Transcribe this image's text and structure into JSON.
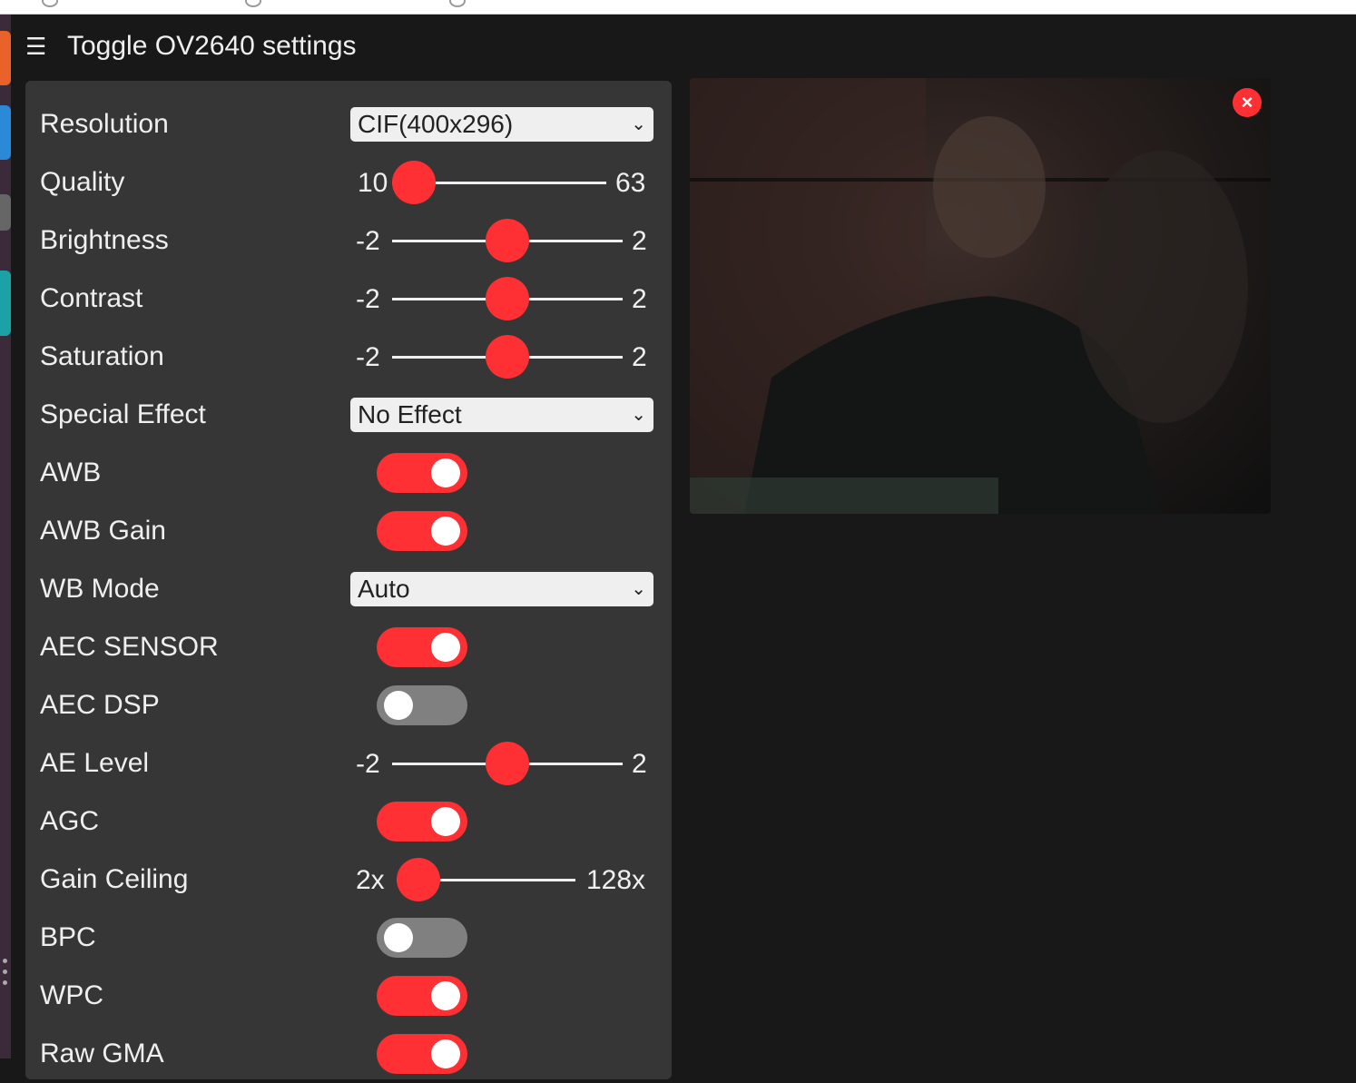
{
  "header": {
    "menu_icon": "☰",
    "title": "Toggle OV2640 settings"
  },
  "settings": {
    "resolution": {
      "label": "Resolution",
      "value": "CIF(400x296)"
    },
    "quality": {
      "label": "Quality",
      "min": "10",
      "max": "63",
      "value_fraction": 0.0
    },
    "brightness": {
      "label": "Brightness",
      "min": "-2",
      "max": "2",
      "value_fraction": 0.5
    },
    "contrast": {
      "label": "Contrast",
      "min": "-2",
      "max": "2",
      "value_fraction": 0.5
    },
    "saturation": {
      "label": "Saturation",
      "min": "-2",
      "max": "2",
      "value_fraction": 0.5
    },
    "special_effect": {
      "label": "Special Effect",
      "value": "No Effect"
    },
    "awb": {
      "label": "AWB",
      "on": true
    },
    "awb_gain": {
      "label": "AWB Gain",
      "on": true
    },
    "wb_mode": {
      "label": "WB Mode",
      "value": "Auto"
    },
    "aec_sensor": {
      "label": "AEC SENSOR",
      "on": true
    },
    "aec_dsp": {
      "label": "AEC DSP",
      "on": false
    },
    "ae_level": {
      "label": "AE Level",
      "min": "-2",
      "max": "2",
      "value_fraction": 0.5
    },
    "agc": {
      "label": "AGC",
      "on": true
    },
    "gain_ceiling": {
      "label": "Gain Ceiling",
      "min": "2x",
      "max": "128x",
      "value_fraction": 0.0
    },
    "bpc": {
      "label": "BPC",
      "on": false
    },
    "wpc": {
      "label": "WPC",
      "on": true
    },
    "raw_gma": {
      "label": "Raw GMA",
      "on": true
    }
  },
  "stream": {
    "close_icon": "×"
  },
  "colors": {
    "accent": "#ff3034",
    "panel": "#363636",
    "background": "#181818",
    "switch_off": "#808080"
  }
}
